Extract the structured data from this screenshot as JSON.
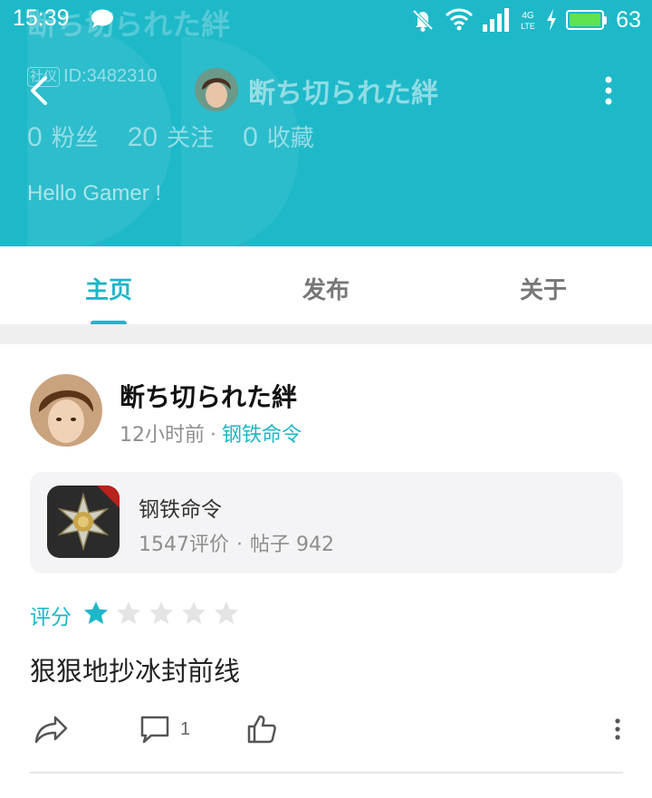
{
  "status_bar": {
    "time": "15:39",
    "network": "4G LTE",
    "battery_percent": "63",
    "icons": [
      "chat-bubble-icon",
      "mute-icon",
      "wifi-icon",
      "signal-icon",
      "charging-icon",
      "battery-icon"
    ]
  },
  "header": {
    "ghost_title": "断ち切られた絆",
    "tag": "社仪",
    "user_id": "ID:3482310",
    "username": "断ち切られた絆",
    "stats": [
      {
        "value": "0",
        "label": "粉丝"
      },
      {
        "value": "20",
        "label": "关注"
      },
      {
        "value": "0",
        "label": "收藏"
      }
    ],
    "bio": "Hello Gamer !",
    "bg_color": "#1eb9c9"
  },
  "tabs": [
    {
      "label": "主页",
      "active": true
    },
    {
      "label": "发布",
      "active": false
    },
    {
      "label": "关于",
      "active": false
    }
  ],
  "post": {
    "author": "断ち切られた絆",
    "time_ago": "12小时前",
    "separator": "·",
    "game_link": "钢铁命令",
    "game_card": {
      "name": "钢铁命令",
      "reviews": "1547评价",
      "posts": "帖子 942",
      "separator": "·"
    },
    "rating_label": "评分",
    "rating": 1,
    "rating_max": 5,
    "text": "狠狠地抄冰封前线",
    "comment_count": "1"
  },
  "colors": {
    "accent": "#1db6c8",
    "star_inactive": "#e4e4e4",
    "card_bg": "#f4f4f6"
  }
}
